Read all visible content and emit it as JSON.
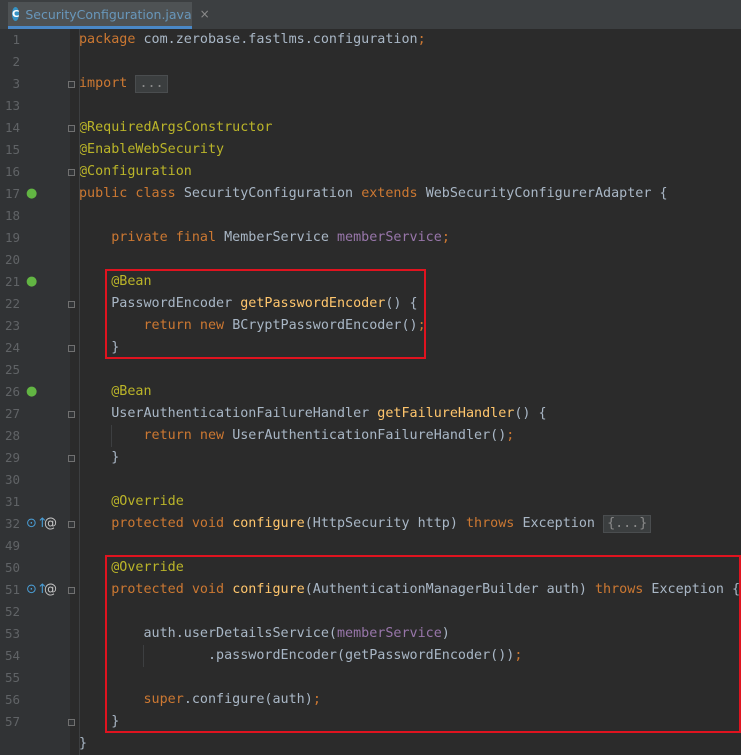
{
  "tab": {
    "filename": "SecurityConfiguration.java",
    "icon": "java-class-icon",
    "close_glyph": "×"
  },
  "colors": {
    "keyword": "#cc7832",
    "annotation": "#bbb529",
    "method": "#ffc66d",
    "field": "#9876aa",
    "text": "#a9b7c6",
    "highlight_box": "#e0131f"
  },
  "lines": [
    {
      "num": "1",
      "tokens": [
        [
          "kw",
          "package "
        ],
        [
          "t",
          "com.zerobase.fastlms.configuration"
        ],
        [
          "kw",
          ";"
        ]
      ]
    },
    {
      "num": "2",
      "tokens": []
    },
    {
      "num": "3",
      "tokens": [
        [
          "kw",
          "import "
        ],
        [
          "fold",
          "..."
        ]
      ]
    },
    {
      "num": "13",
      "tokens": []
    },
    {
      "num": "14",
      "tokens": [
        [
          "an",
          "@RequiredArgsConstructor"
        ]
      ]
    },
    {
      "num": "15",
      "tokens": [
        [
          "an",
          "@EnableWebSecurity"
        ]
      ]
    },
    {
      "num": "16",
      "tokens": [
        [
          "an",
          "@Configuration"
        ]
      ]
    },
    {
      "num": "17",
      "tokens": [
        [
          "kw",
          "public class "
        ],
        [
          "t",
          "SecurityConfiguration "
        ],
        [
          "kw",
          "extends "
        ],
        [
          "t",
          "WebSecurityConfigurerAdapter {"
        ]
      ]
    },
    {
      "num": "18",
      "tokens": []
    },
    {
      "num": "19",
      "tokens": [
        [
          "t",
          "    "
        ],
        [
          "kw",
          "private final "
        ],
        [
          "t",
          "MemberService "
        ],
        [
          "fd",
          "memberService"
        ],
        [
          "kw",
          ";"
        ]
      ]
    },
    {
      "num": "20",
      "tokens": []
    },
    {
      "num": "21",
      "tokens": [
        [
          "t",
          "    "
        ],
        [
          "an",
          "@Bean"
        ]
      ]
    },
    {
      "num": "22",
      "tokens": [
        [
          "t",
          "    PasswordEncoder "
        ],
        [
          "fn",
          "getPasswordEncoder"
        ],
        [
          "t",
          "() {"
        ]
      ]
    },
    {
      "num": "23",
      "tokens": [
        [
          "t",
          "        "
        ],
        [
          "kw",
          "return new "
        ],
        [
          "t",
          "BCryptPasswordEncoder()"
        ],
        [
          "kw",
          ";"
        ]
      ]
    },
    {
      "num": "24",
      "tokens": [
        [
          "t",
          "    }"
        ]
      ]
    },
    {
      "num": "25",
      "tokens": []
    },
    {
      "num": "26",
      "tokens": [
        [
          "t",
          "    "
        ],
        [
          "an",
          "@Bean"
        ]
      ]
    },
    {
      "num": "27",
      "tokens": [
        [
          "t",
          "    UserAuthenticationFailureHandler "
        ],
        [
          "fn",
          "getFailureHandler"
        ],
        [
          "t",
          "() {"
        ]
      ]
    },
    {
      "num": "28",
      "tokens": [
        [
          "t",
          "        "
        ],
        [
          "kw",
          "return new "
        ],
        [
          "t",
          "UserAuthenticationFailureHandler()"
        ],
        [
          "kw",
          ";"
        ]
      ]
    },
    {
      "num": "29",
      "tokens": [
        [
          "t",
          "    }"
        ]
      ]
    },
    {
      "num": "30",
      "tokens": []
    },
    {
      "num": "31",
      "tokens": [
        [
          "t",
          "    "
        ],
        [
          "an",
          "@Override"
        ]
      ]
    },
    {
      "num": "32",
      "tokens": [
        [
          "t",
          "    "
        ],
        [
          "kw",
          "protected void "
        ],
        [
          "fn",
          "configure"
        ],
        [
          "t",
          "(HttpSecurity http) "
        ],
        [
          "kw",
          "throws "
        ],
        [
          "t",
          "Exception "
        ],
        [
          "fold",
          "{...}"
        ]
      ]
    },
    {
      "num": "49",
      "tokens": []
    },
    {
      "num": "50",
      "tokens": [
        [
          "t",
          "    "
        ],
        [
          "an",
          "@Override"
        ]
      ]
    },
    {
      "num": "51",
      "tokens": [
        [
          "t",
          "    "
        ],
        [
          "kw",
          "protected void "
        ],
        [
          "fn",
          "configure"
        ],
        [
          "t",
          "(AuthenticationManagerBuilder auth) "
        ],
        [
          "kw",
          "throws "
        ],
        [
          "t",
          "Exception {"
        ]
      ]
    },
    {
      "num": "52",
      "tokens": []
    },
    {
      "num": "53",
      "tokens": [
        [
          "t",
          "        auth.userDetailsService("
        ],
        [
          "fd",
          "memberService"
        ],
        [
          "t",
          ")"
        ]
      ]
    },
    {
      "num": "54",
      "tokens": [
        [
          "t",
          "                .passwordEncoder(getPasswordEncoder())"
        ],
        [
          "kw",
          ";"
        ]
      ]
    },
    {
      "num": "55",
      "tokens": []
    },
    {
      "num": "56",
      "tokens": [
        [
          "t",
          "        "
        ],
        [
          "kw",
          "super"
        ],
        [
          "t",
          ".configure(auth)"
        ],
        [
          "kw",
          ";"
        ]
      ]
    },
    {
      "num": "57",
      "tokens": [
        [
          "t",
          "    }"
        ]
      ]
    },
    {
      "num": "",
      "tokens": [
        [
          "t",
          "}"
        ]
      ]
    }
  ],
  "gutter_icons": [
    {
      "line": "17",
      "name": "spring-bean-icon",
      "glyph": "●"
    },
    {
      "line": "21",
      "name": "spring-bean-icon",
      "glyph": "●"
    },
    {
      "line": "26",
      "name": "spring-bean-icon",
      "glyph": "●"
    },
    {
      "line": "32",
      "name": "override-icon",
      "glyph": "⊙↑"
    },
    {
      "line": "32",
      "name": "annotation-at-icon",
      "glyph": "@"
    },
    {
      "line": "51",
      "name": "override-icon",
      "glyph": "⊙↑"
    },
    {
      "line": "51",
      "name": "annotation-at-icon",
      "glyph": "@"
    }
  ]
}
